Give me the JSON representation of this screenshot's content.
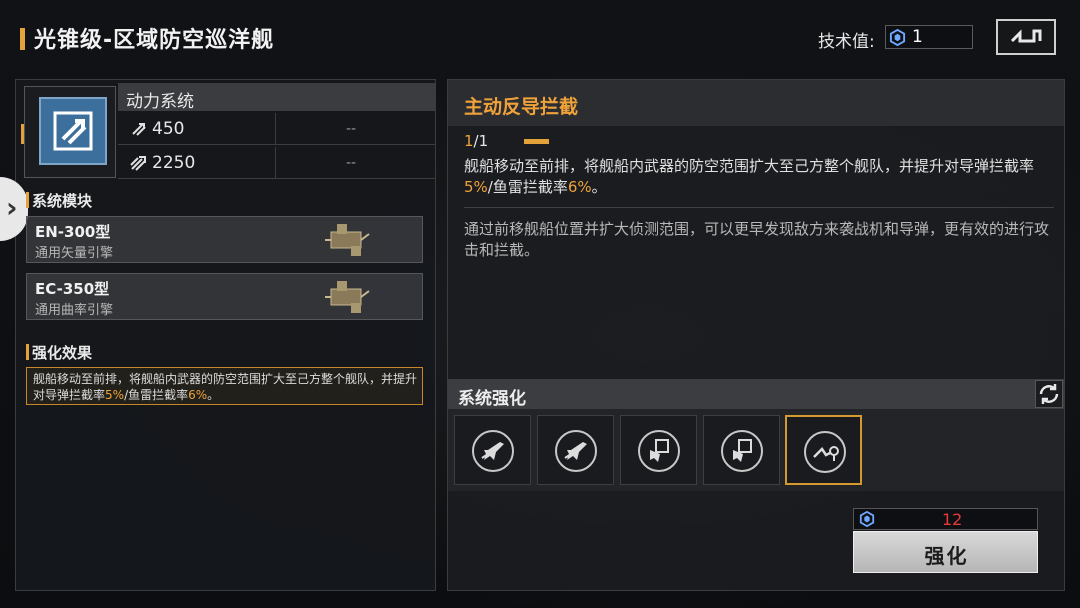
{
  "header": {
    "title": "光锥级-区域防空巡洋舰",
    "tech_label": "技术值:",
    "tech_value": "1",
    "back_icon": "back-arrow-icon"
  },
  "system": {
    "name": "动力系统",
    "icon": "engine-thrust-icon",
    "stats": [
      {
        "icon": "speed-icon",
        "value": "450",
        "next": "--"
      },
      {
        "icon": "boost-icon",
        "value": "2250",
        "next": "--"
      }
    ]
  },
  "modules": {
    "title": "系统模块",
    "items": [
      {
        "name": "EN-300型",
        "desc": "通用矢量引擎"
      },
      {
        "name": "EC-350型",
        "desc": "通用曲率引擎"
      }
    ]
  },
  "effect": {
    "title": "强化效果",
    "text_pre": "舰船移动至前排，将舰船内武器的防空范围扩大至己方整个舰队，并提升对导弹拦截率",
    "v1": "5%",
    "mid": "/鱼雷拦截率",
    "v2": "6%",
    "end": "。"
  },
  "skill": {
    "name": "主动反导拦截",
    "level_current": "1",
    "level_max": "/1",
    "desc_pre": "舰船移动至前排，将舰船内武器的防空范围扩大至己方整个舰队，并提升对导弹拦截率",
    "v1": "5%",
    "mid": "/鱼雷拦截率",
    "v2": "6%",
    "end": "。",
    "note": "通过前移舰船位置并扩大侦测范围，可以更早发现敌方来袭战机和导弹，更有效的进行攻击和拦截。"
  },
  "enhance": {
    "title": "系统强化",
    "refresh_icon": "refresh-icon",
    "slots": [
      {
        "icon": "fighter-icon"
      },
      {
        "icon": "fighter-icon"
      },
      {
        "icon": "drone-shield-icon"
      },
      {
        "icon": "drone-shield-icon"
      },
      {
        "icon": "move-forward-icon",
        "selected": true
      }
    ],
    "cost": "12",
    "button_label": "强化"
  },
  "colors": {
    "accent": "#e3a23a",
    "cost_red": "#e83a3a",
    "system_icon_bg": "#3c6f9c"
  }
}
